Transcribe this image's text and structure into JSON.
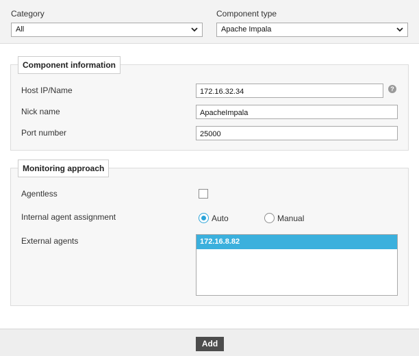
{
  "filters": {
    "category_label": "Category",
    "category_value": "All",
    "component_type_label": "Component type",
    "component_type_value": "Apache Impala"
  },
  "component_info": {
    "legend": "Component information",
    "host_label": "Host IP/Name",
    "host_value": "172.16.32.34",
    "nick_label": "Nick name",
    "nick_value": "ApacheImpala",
    "port_label": "Port number",
    "port_value": "25000",
    "help_icon": "question-circle-icon"
  },
  "monitoring": {
    "legend": "Monitoring approach",
    "agentless_label": "Agentless",
    "agentless_checked": false,
    "internal_agent_label": "Internal agent assignment",
    "options": [
      "Auto",
      "Manual"
    ],
    "selected_option": "Auto",
    "external_agents_label": "External agents",
    "external_agents": [
      "172.16.8.82"
    ]
  },
  "footer": {
    "add_label": "Add"
  },
  "colors": {
    "accent": "#3bb0dd",
    "button": "#4c4c4c",
    "panel": "#f7f7f7"
  }
}
